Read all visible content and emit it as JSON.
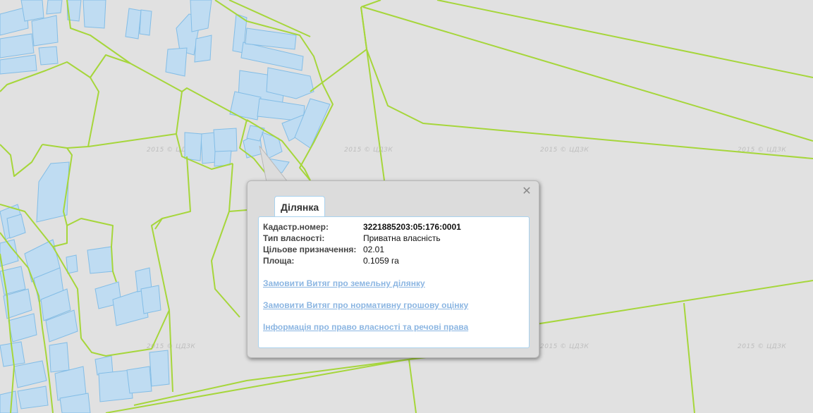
{
  "map": {
    "watermark": "2015 © ЦДЗК",
    "colors": {
      "background": "#e1e1e1",
      "boundary": "#a6d63b",
      "parcel_fill": "#bfdcf2",
      "parcel_stroke": "#83bde6"
    }
  },
  "popup": {
    "close_label": "✕",
    "tab_title": "Ділянка",
    "properties": [
      {
        "label": "Кадастр.номер:",
        "value": "3221885203:05:176:0001"
      },
      {
        "label": "Тип власності:",
        "value": "Приватна власність"
      },
      {
        "label": "Цільове призначення:",
        "value": "02.01"
      },
      {
        "label": "Площа:",
        "value": "0.1059 га"
      }
    ],
    "links": [
      "Замовити Витяг про земельну ділянку",
      "Замовити Витяг про нормативну грошову оцінку",
      "Інформація про право власності та речові права"
    ]
  }
}
